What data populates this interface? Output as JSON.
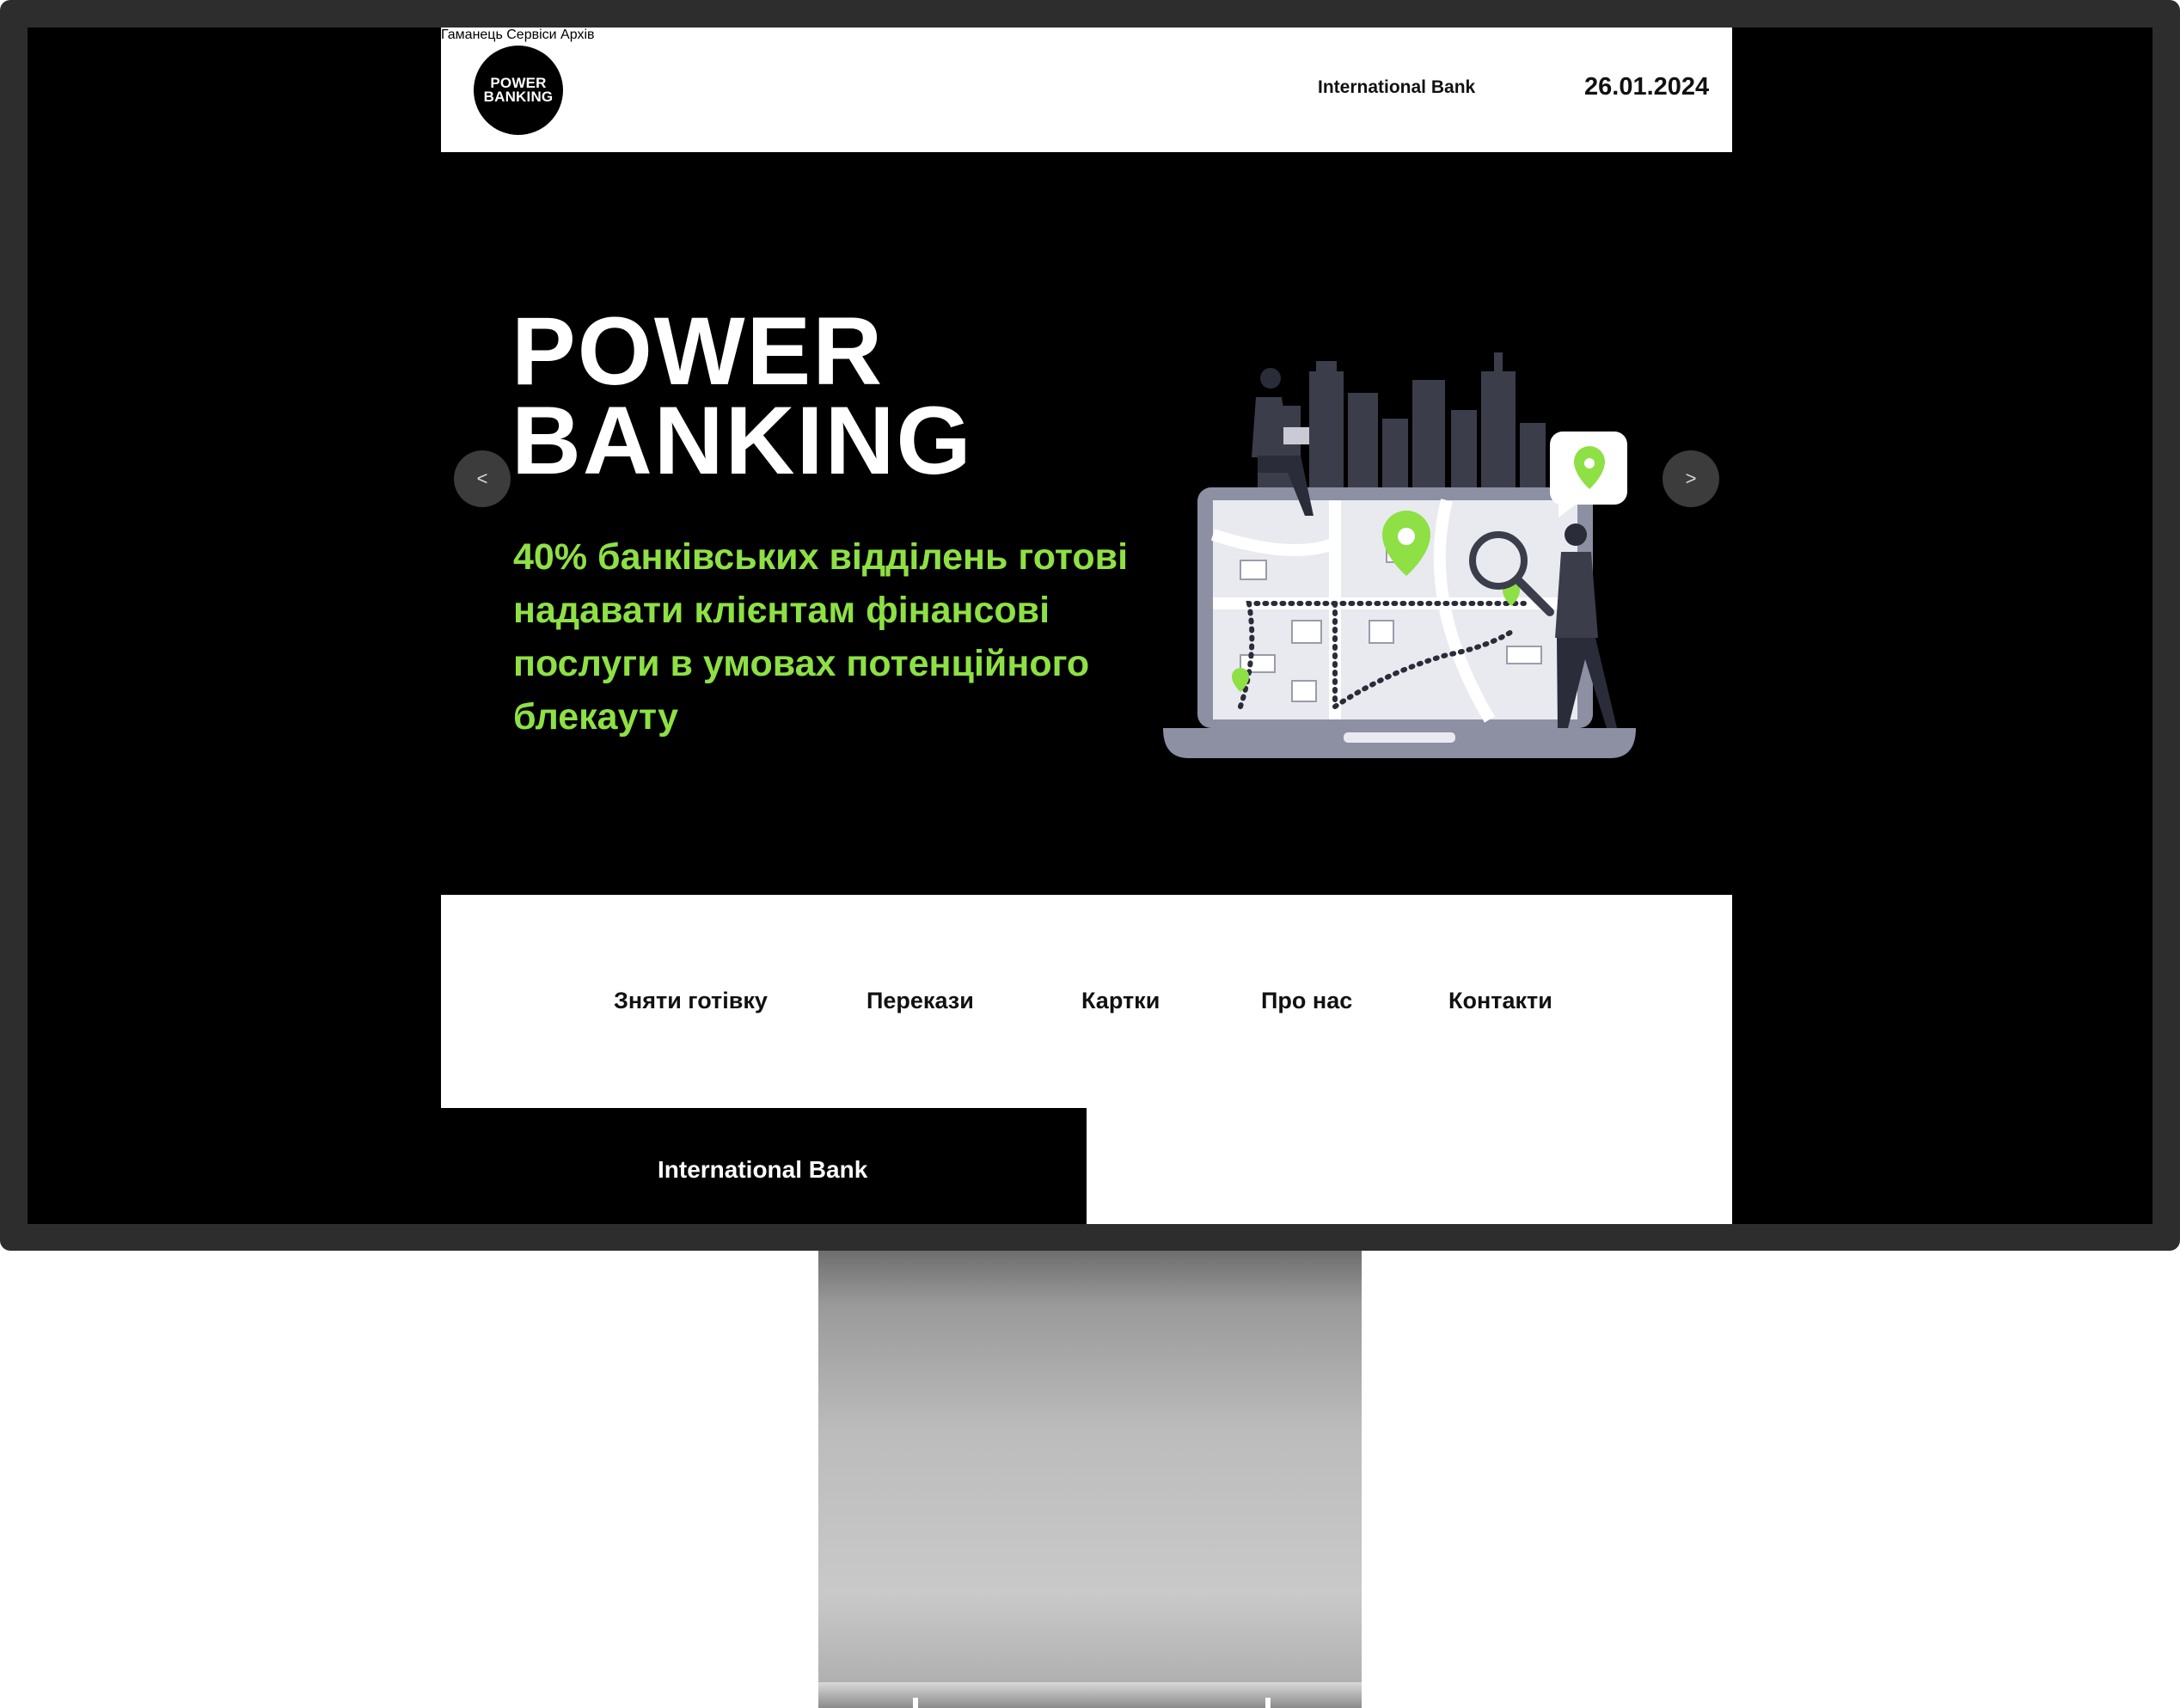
{
  "header": {
    "logo": {
      "line1": "POWER",
      "line2": "BANKING"
    },
    "nav": [
      "Гаманець",
      "Сервіси",
      "Архів"
    ],
    "bank_name": "International Bank",
    "date": "26.01.2024"
  },
  "hero": {
    "title_line1": "POWER",
    "title_line2": "BANKING",
    "subtitle": "40% банківських відділень готові надавати клієнтам фінансові послуги в умовах потенційного блекауту",
    "prev_label": "<",
    "next_label": ">"
  },
  "menu": [
    "Зняти готівку",
    "Перекази",
    "Картки",
    "Про нас",
    "Контакти"
  ],
  "footer": {
    "bank_name": "International Bank"
  },
  "colors": {
    "accent_green": "#8ee045",
    "background": "#000000",
    "surface": "#ffffff",
    "monitor_frame": "#2d2d2d"
  },
  "icons": {
    "illustration": "laptop-map-illustration",
    "pin": "location-pin-icon"
  }
}
